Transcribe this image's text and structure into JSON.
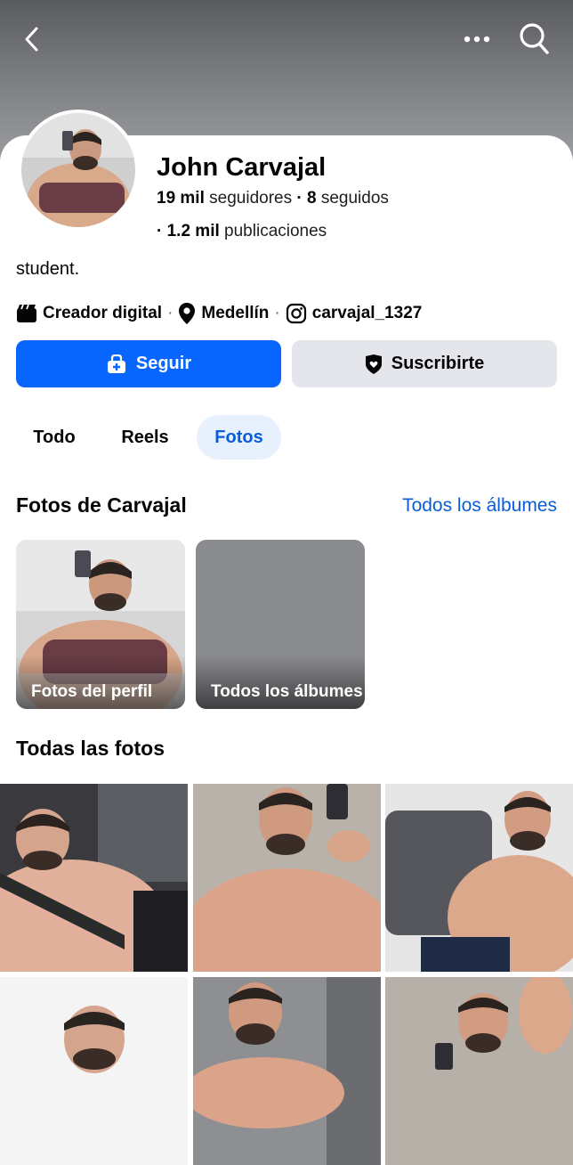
{
  "nav": {
    "back_icon": "chevron-left-icon",
    "more_icon": "more-horizontal-icon",
    "search_icon": "search-icon"
  },
  "profile": {
    "name": "John Carvajal",
    "followers_count": "19 mil",
    "followers_label": "seguidores",
    "following_count": "8",
    "following_label": "seguidos",
    "posts_count": "1.2 mil",
    "posts_label": "publicaciones",
    "bio": "student.",
    "category": "Creador digital",
    "location": "Medellín",
    "instagram": "carvajal_1327"
  },
  "actions": {
    "follow_label": "Seguir",
    "subscribe_label": "Suscribirte"
  },
  "tabs": [
    {
      "label": "Todo",
      "active": false
    },
    {
      "label": "Reels",
      "active": false
    },
    {
      "label": "Fotos",
      "active": true
    }
  ],
  "photos_section": {
    "title": "Fotos de Carvajal",
    "all_albums_link": "Todos los álbumes",
    "albums": [
      {
        "label": "Fotos del perfil"
      },
      {
        "label": "Todos los álbumes"
      }
    ]
  },
  "all_photos": {
    "title": "Todas las fotos"
  },
  "colors": {
    "accent": "#0866ff",
    "link": "#0a5dd6",
    "secondary_button": "#e4e6eb",
    "active_tab_bg": "#e7f0fd"
  }
}
